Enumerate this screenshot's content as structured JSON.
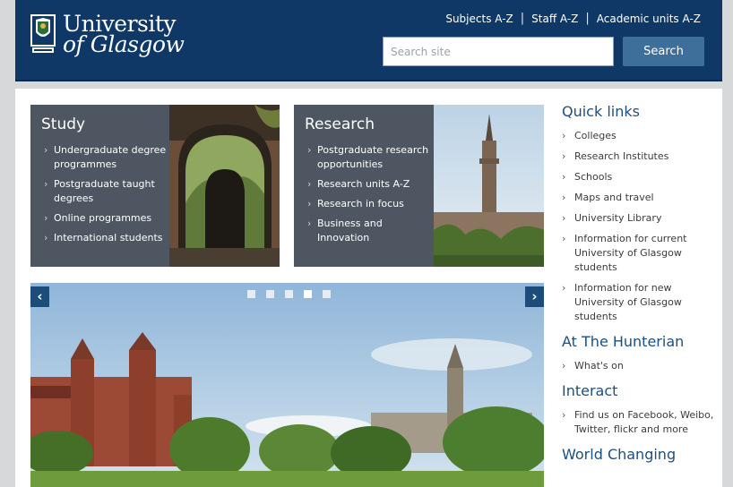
{
  "header": {
    "logo_line1": "University",
    "logo_line2": "of Glasgow",
    "links": [
      "Subjects A-Z",
      "Staff A-Z",
      "Academic units A-Z"
    ],
    "search_placeholder": "Search site",
    "search_button": "Search",
    "colors": {
      "header_bg": "#0f3866",
      "button_bg": "#3e6e9a"
    }
  },
  "study": {
    "title": "Study",
    "items": [
      "Undergraduate degree programmes",
      "Postgraduate taught degrees",
      "Online programmes",
      "International students"
    ]
  },
  "research": {
    "title": "Research",
    "items": [
      "Postgraduate research opportunities",
      "Research units A-Z",
      "Research in focus",
      "Business and Innovation"
    ]
  },
  "carousel": {
    "prev_icon": "chevron-left-icon",
    "next_icon": "chevron-right-icon",
    "prev_glyph": "‹",
    "next_glyph": "›",
    "slide_count": 5,
    "active_index": 3
  },
  "sidebar": {
    "quick_links_title": "Quick links",
    "quick_links": [
      "Colleges",
      "Research Institutes",
      "Schools",
      "Maps and travel",
      "University Library",
      "Information for current University of Glasgow students",
      "Information for new University of Glasgow students"
    ],
    "hunterian_title": "At The Hunterian",
    "hunterian_links": [
      "What's on"
    ],
    "interact_title": "Interact",
    "interact_links": [
      "Find us on Facebook, Weibo, Twitter, flickr and more"
    ],
    "world_title": "World Changing",
    "heading_color": "#1c4f82"
  }
}
